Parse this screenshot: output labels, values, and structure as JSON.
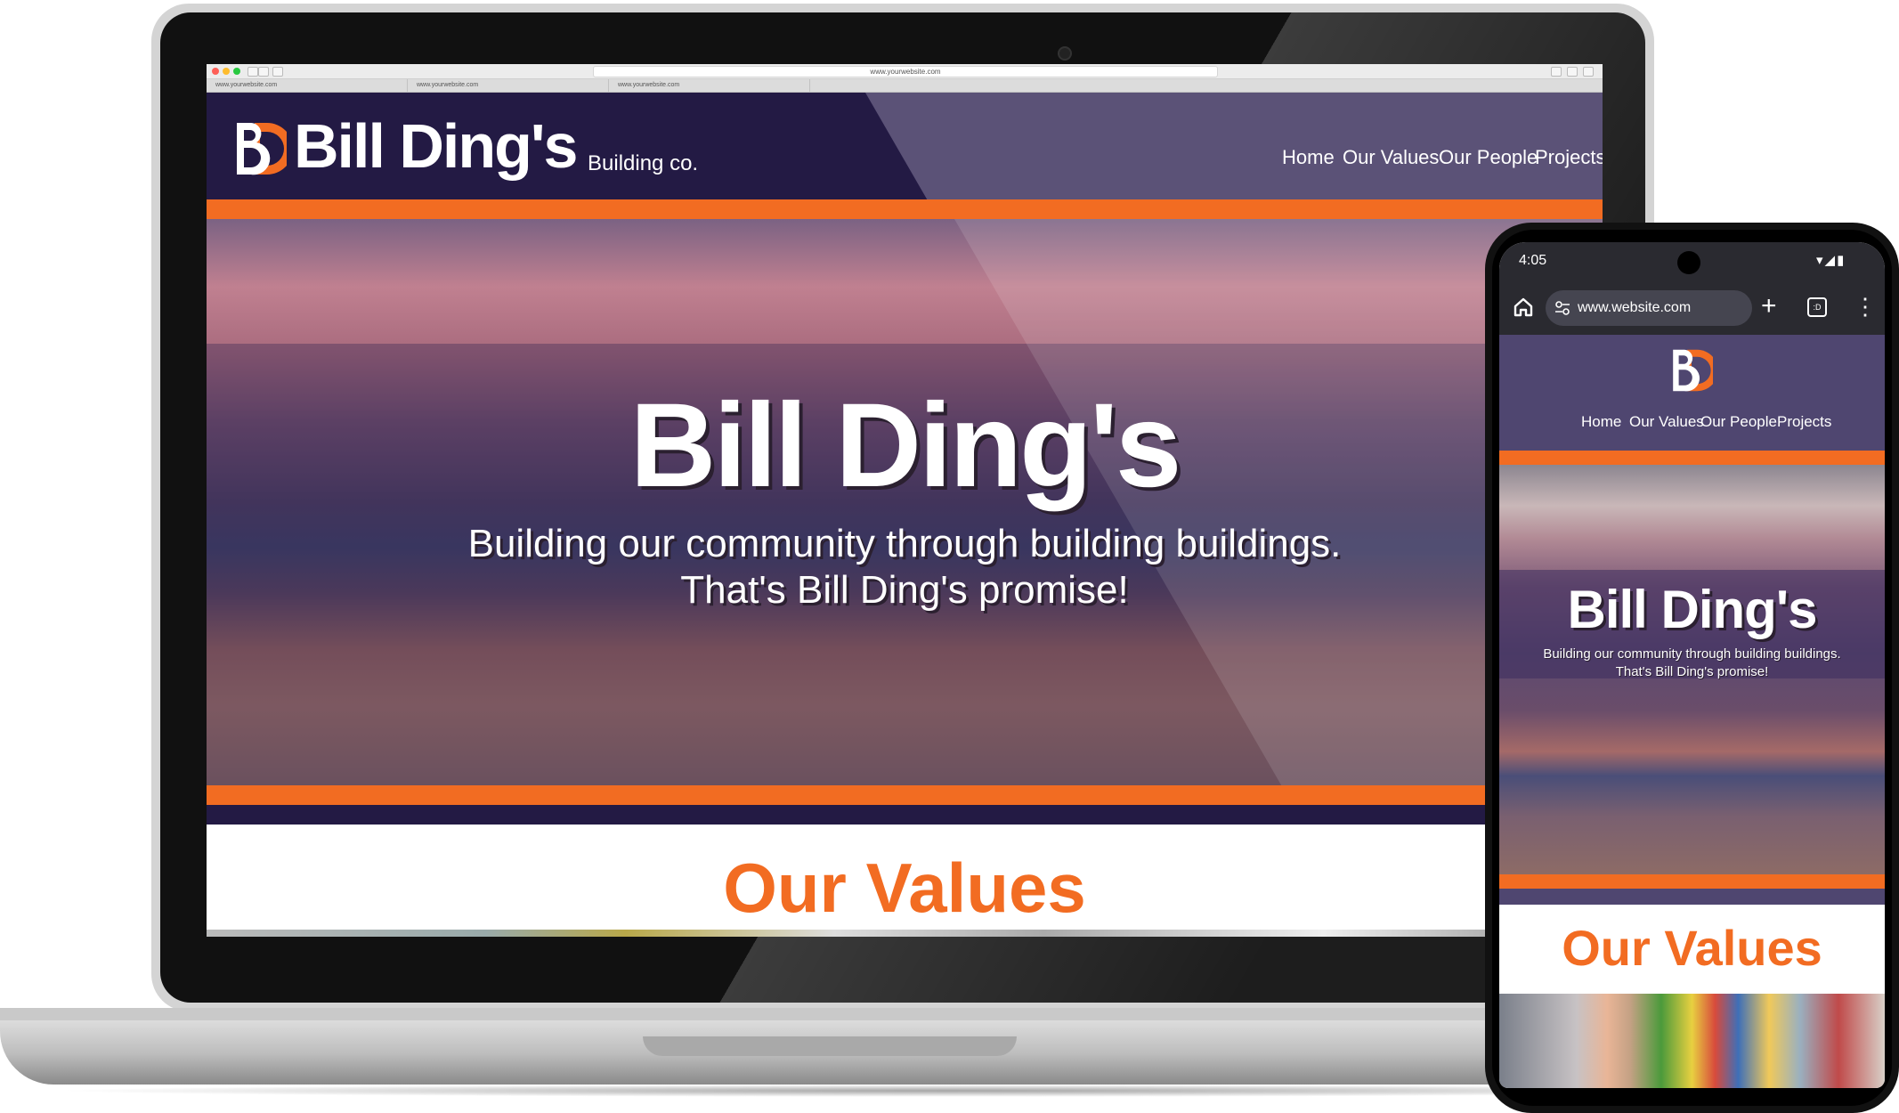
{
  "laptop": {
    "browser": {
      "address": "www.yourwebsite.com",
      "tabs": [
        "www.yourwebsite.com",
        "www.yourwebsite.com",
        "www.yourwebsite.com"
      ]
    },
    "site": {
      "logo_letters": "BD",
      "brand_name": "Bill Ding's",
      "brand_sub": "Building co.",
      "nav": [
        "Home",
        "Our Values",
        "Our People",
        "Projects"
      ],
      "hero_title": "Bill Ding's",
      "hero_line1": "Building our community through building buildings.",
      "hero_line2": "That's Bill Ding's promise!",
      "section_heading": "Our Values"
    }
  },
  "phone": {
    "status": {
      "time": "4:05",
      "icons": "▾◢▮"
    },
    "chrome": {
      "url": "www.website.com",
      "new_tab": "+",
      "tab_count": ":D",
      "menu": "⋮"
    },
    "site": {
      "logo_letters": "BD",
      "nav": [
        "Home",
        "Our Values",
        "Our People",
        "Projects"
      ],
      "hero_title": "Bill Ding's",
      "hero_line1": "Building our community through building buildings.",
      "hero_line2": "That's Bill Ding's promise!",
      "section_heading": "Our Values"
    }
  },
  "colors": {
    "brand_orange": "#f26c22",
    "brand_purple": "#231a44",
    "mobile_purple": "#4f4670"
  }
}
